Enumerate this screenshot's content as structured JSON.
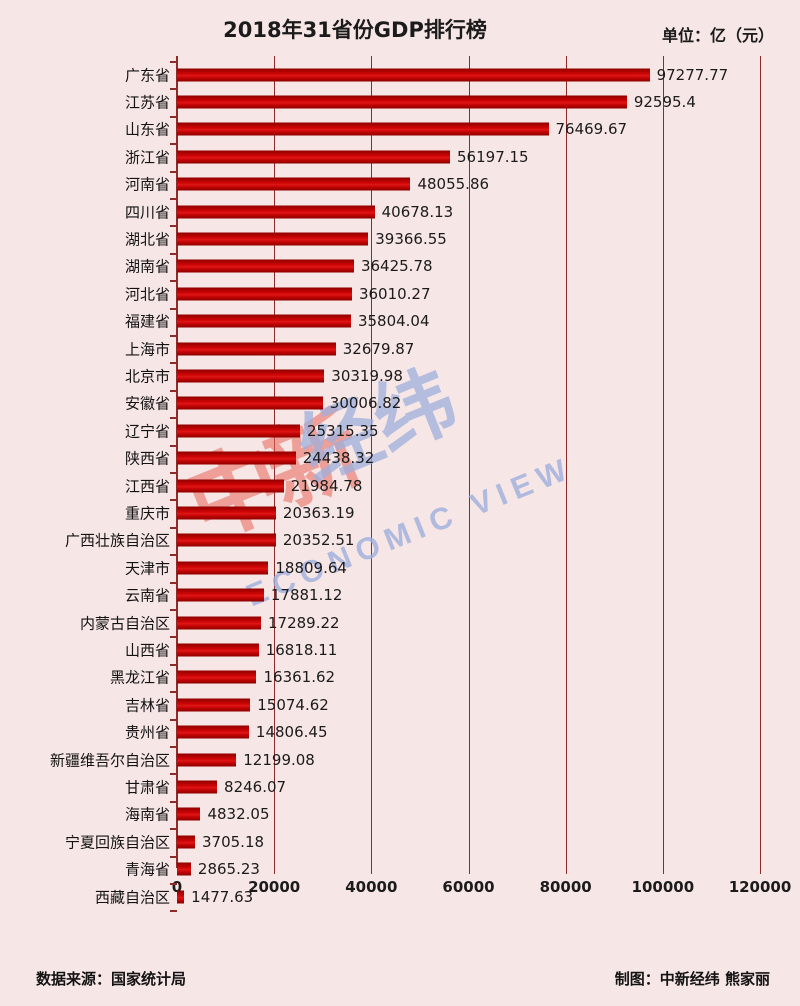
{
  "header": {
    "title": "2018年31省份GDP排行榜",
    "unit_label": "单位：亿（元）"
  },
  "watermark": {
    "logo_text": "中新",
    "cn_text": "经纬",
    "en_text": "ECONOMIC VIEW"
  },
  "footer": {
    "source": "数据来源：国家统计局",
    "credit": "制图：中新经纬 熊家丽"
  },
  "colors": {
    "background": "#f7e6e6",
    "bar": "#cf0505",
    "bar_dark": "#8f0000",
    "gridline": "#8d2a2a",
    "text": "#1b1b1b",
    "watermark_blue": "#9fb0dd",
    "watermark_red": "#e8665a"
  },
  "chart_data": {
    "type": "bar",
    "orientation": "horizontal",
    "title": "2018年31省份GDP排行榜",
    "xlabel": "",
    "ylabel": "",
    "unit": "亿（元）",
    "xlim": [
      0,
      120000
    ],
    "xticks": [
      0,
      20000,
      40000,
      60000,
      80000,
      100000,
      120000
    ],
    "xtick_labels": [
      "0",
      "20000",
      "40000",
      "60000",
      "80000",
      "100000",
      "120000"
    ],
    "grid": true,
    "grid_axis": "x",
    "legend": false,
    "source": "国家统计局",
    "categories": [
      "广东省",
      "江苏省",
      "山东省",
      "浙江省",
      "河南省",
      "四川省",
      "湖北省",
      "湖南省",
      "河北省",
      "福建省",
      "上海市",
      "北京市",
      "安徽省",
      "辽宁省",
      "陕西省",
      "江西省",
      "重庆市",
      "广西壮族自治区",
      "天津市",
      "云南省",
      "内蒙古自治区",
      "山西省",
      "黑龙江省",
      "吉林省",
      "贵州省",
      "新疆维吾尔自治区",
      "甘肃省",
      "海南省",
      "宁夏回族自治区",
      "青海省",
      "西藏自治区"
    ],
    "values": [
      97277.77,
      92595.4,
      76469.67,
      56197.15,
      48055.86,
      40678.13,
      39366.55,
      36425.78,
      36010.27,
      35804.04,
      32679.87,
      30319.98,
      30006.82,
      25315.35,
      24438.32,
      21984.78,
      20363.19,
      20352.51,
      18809.64,
      17881.12,
      17289.22,
      16818.11,
      16361.62,
      15074.62,
      14806.45,
      12199.08,
      8246.07,
      4832.05,
      3705.18,
      2865.23,
      1477.63
    ],
    "value_labels": [
      "97277.77",
      "92595.4",
      "76469.67",
      "56197.15",
      "48055.86",
      "40678.13",
      "39366.55",
      "36425.78",
      "36010.27",
      "35804.04",
      "32679.87",
      "30319.98",
      "30006.82",
      "25315.35",
      "24438.32",
      "21984.78",
      "20363.19",
      "20352.51",
      "18809.64",
      "17881.12",
      "17289.22",
      "16818.11",
      "16361.62",
      "15074.62",
      "14806.45",
      "12199.08",
      "8246.07",
      "4832.05",
      "3705.18",
      "2865.23",
      "1477.63"
    ]
  }
}
